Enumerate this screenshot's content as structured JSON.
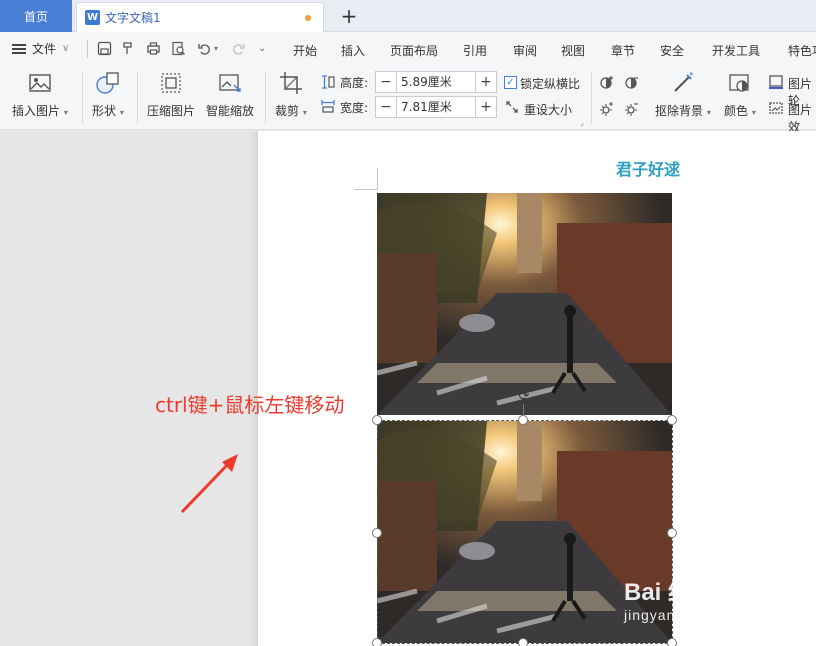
{
  "tabs": {
    "home": "首页",
    "document": "文字文稿1"
  },
  "menu": {
    "file": "文件",
    "items": [
      "开始",
      "插入",
      "页面布局",
      "引用",
      "审阅",
      "视图",
      "章节",
      "安全",
      "开发工具",
      "特色功"
    ]
  },
  "ribbon": {
    "insert_picture": "插入图片",
    "shape": "形状",
    "compress_picture": "压缩图片",
    "smart_zoom": "智能缩放",
    "crop": "裁剪",
    "height_label": "高度:",
    "height_value": "5.89厘米",
    "width_label": "宽度:",
    "width_value": "7.81厘米",
    "lock_ratio": "锁定纵横比",
    "reset_size": "重设大小",
    "remove_background": "抠除背景",
    "color": "颜色",
    "picture_outline": "图片轮",
    "picture_effect": "图片效"
  },
  "document": {
    "heading": "君子好逑"
  },
  "annotation": {
    "text": "ctrl键+鼠标左键移动"
  },
  "watermark": {
    "line1": "Bai  经验",
    "line2": "jingyan.baidu.com"
  },
  "colors": {
    "accent": "#4a7fd6",
    "heading": "#2ea0c4",
    "annotation": "#ee3a2e"
  }
}
